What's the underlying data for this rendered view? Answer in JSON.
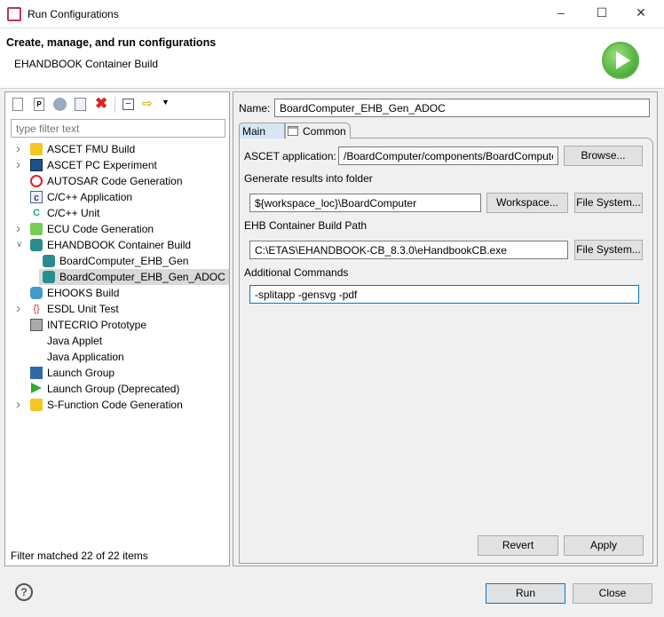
{
  "window": {
    "title": "Run Configurations",
    "controls": [
      "minimize",
      "maximize",
      "close"
    ]
  },
  "header": {
    "title": "Create, manage, and run configurations",
    "subtitle": "EHANDBOOK Container Build",
    "icon": "run-play-icon"
  },
  "left": {
    "toolbar": [
      "new-configuration-icon",
      "new-prototype-icon",
      "export-icon",
      "duplicate-icon",
      "delete-icon",
      "collapse-all-icon",
      "filter-icon",
      "dropdown-icon"
    ],
    "filter_placeholder": "type filter text",
    "tree": [
      {
        "label": "ASCET FMU Build",
        "level": 0,
        "expander": "collapsed",
        "icon": "ascet-fmu-icon"
      },
      {
        "label": "ASCET PC Experiment",
        "level": 0,
        "expander": "collapsed",
        "icon": "ascet-pc-icon"
      },
      {
        "label": "AUTOSAR Code Generation",
        "level": 0,
        "expander": "none",
        "icon": "autosar-icon"
      },
      {
        "label": "C/C++ Application",
        "level": 0,
        "expander": "none",
        "icon": "c-app-icon"
      },
      {
        "label": "C/C++ Unit",
        "level": 0,
        "expander": "none",
        "icon": "c-unit-icon"
      },
      {
        "label": "ECU Code Generation",
        "level": 0,
        "expander": "collapsed",
        "icon": "ecu-codegen-icon"
      },
      {
        "label": "EHANDBOOK Container Build",
        "level": 0,
        "expander": "expanded",
        "icon": "ehandbook-icon"
      },
      {
        "label": "BoardComputer_EHB_Gen",
        "level": 1,
        "expander": "none",
        "icon": "ehandbook-icon"
      },
      {
        "label": "BoardComputer_EHB_Gen_ADOC",
        "level": 1,
        "expander": "none",
        "icon": "ehandbook-icon",
        "selected": true
      },
      {
        "label": "EHOOKS Build",
        "level": 0,
        "expander": "none",
        "icon": "ehooks-icon"
      },
      {
        "label": "ESDL Unit Test",
        "level": 0,
        "expander": "collapsed",
        "icon": "braces-icon"
      },
      {
        "label": "INTECRIO Prototype",
        "level": 0,
        "expander": "none",
        "icon": "intecrio-icon"
      },
      {
        "label": "Java Applet",
        "level": 0,
        "expander": "none",
        "icon": ""
      },
      {
        "label": "Java Application",
        "level": 0,
        "expander": "none",
        "icon": ""
      },
      {
        "label": "Launch Group",
        "level": 0,
        "expander": "none",
        "icon": "launch-group-icon"
      },
      {
        "label": "Launch Group (Deprecated)",
        "level": 0,
        "expander": "none",
        "icon": "play-icon"
      },
      {
        "label": "S-Function Code Generation",
        "level": 0,
        "expander": "collapsed",
        "icon": "ascet-fmu-icon"
      }
    ],
    "status": "Filter matched 22 of 22 items"
  },
  "right": {
    "name_label": "Name:",
    "name_value": "BoardComputer_EHB_Gen_ADOC",
    "tabs": [
      {
        "label": "Main",
        "active": true
      },
      {
        "label": "Common",
        "active": false
      }
    ],
    "ascet_label": "ASCET application:",
    "ascet_value": "/BoardComputer/components/BoardComputer",
    "browse": "Browse...",
    "results_label": "Generate results into folder",
    "results_value": "${workspace_loc}\\BoardComputer",
    "workspace": "Workspace...",
    "filesystem": "File System...",
    "path_label": "EHB Container Build Path",
    "path_value": "C:\\ETAS\\EHANDBOOK-CB_8.3.0\\eHandbookCB.exe",
    "cmd_label": "Additional Commands",
    "cmd_value": "-splitapp -gensvg -pdf",
    "revert": "Revert",
    "apply": "Apply"
  },
  "footer": {
    "run": "Run",
    "close": "Close",
    "help_icon": "help-icon"
  }
}
